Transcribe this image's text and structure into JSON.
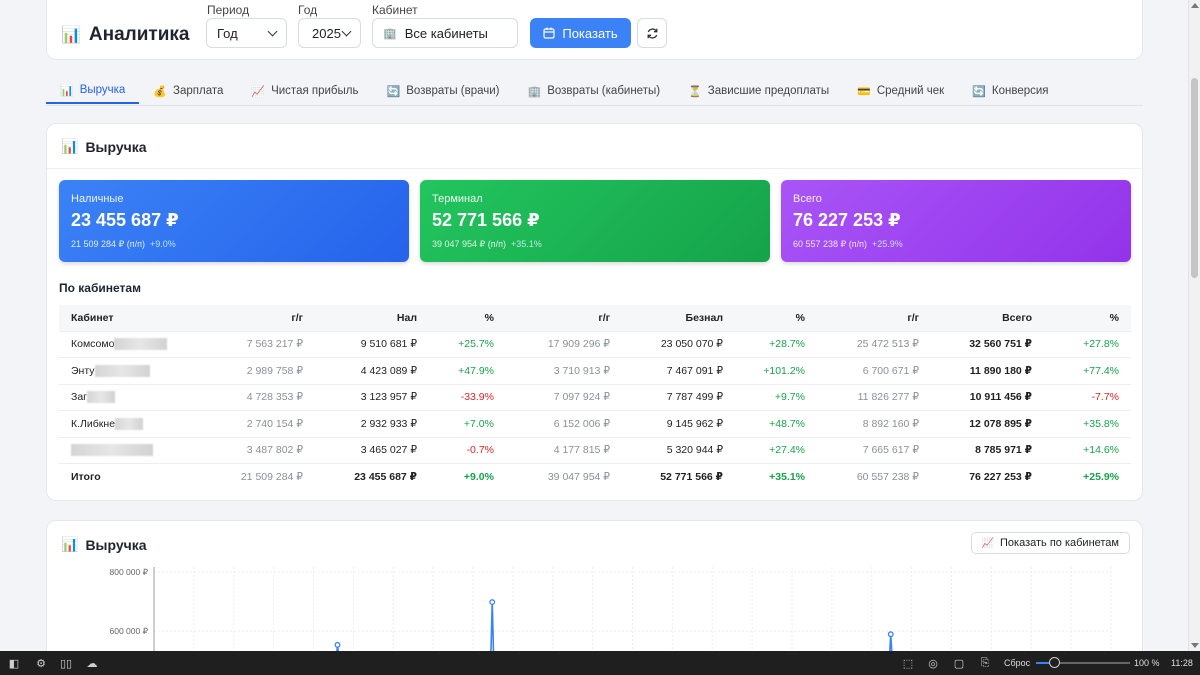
{
  "app": {
    "icon": "bar-chart-icon",
    "title": "Аналитика"
  },
  "filters": {
    "period_label": "Период",
    "period_value": "Год",
    "year_label": "Год",
    "year_value": "2025",
    "cabinet_label": "Кабинет",
    "cabinet_value": "Все кабинеты",
    "show_button": "Показать"
  },
  "tabs": [
    {
      "icon": "bar-chart-icon",
      "glyph": "📊",
      "label": "Выручка",
      "active": true
    },
    {
      "icon": "money-bag-icon",
      "glyph": "💰",
      "label": "Зарплата"
    },
    {
      "icon": "trend-chart-icon",
      "glyph": "📈",
      "label": "Чистая прибыль"
    },
    {
      "icon": "refund-icon",
      "glyph": "🔄",
      "label": "Возвраты (врачи)"
    },
    {
      "icon": "building-icon",
      "glyph": "🏢",
      "label": "Возвраты (кабинеты)"
    },
    {
      "icon": "hourglass-icon",
      "glyph": "⏳",
      "label": "Зависшие предоплаты"
    },
    {
      "icon": "card-icon",
      "glyph": "💳",
      "label": "Средний чек"
    },
    {
      "icon": "conversion-icon",
      "glyph": "🔄",
      "label": "Конверсия"
    }
  ],
  "revenue": {
    "title": "Выручка",
    "cards": [
      {
        "label": "Наличные",
        "value": "23 455 687 ₽",
        "prev": "21 509 284 ₽ (п/п)",
        "change": "+9.0%"
      },
      {
        "label": "Терминал",
        "value": "52 771 566 ₽",
        "prev": "39 047 954 ₽ (п/п)",
        "change": "+35.1%"
      },
      {
        "label": "Всего",
        "value": "76 227 253 ₽",
        "prev": "60 557 238 ₽ (п/п)",
        "change": "+25.9%"
      }
    ],
    "by_cabinet_label": "По кабинетам",
    "columns": [
      "Кабинет",
      "г/г",
      "Нал",
      "%",
      "г/г",
      "Безнал",
      "%",
      "г/г",
      "Всего",
      "%"
    ],
    "rows": [
      [
        "Комсомо",
        "7 563 217 ₽",
        "9 510 681 ₽",
        "+25.7%",
        "17 909 296 ₽",
        "23 050 070 ₽",
        "+28.7%",
        "25 472 513 ₽",
        "32 560 751 ₽",
        "+27.8%"
      ],
      [
        "Энту",
        "2 989 758 ₽",
        "4 423 089 ₽",
        "+47.9%",
        "3 710 913 ₽",
        "7 467 091 ₽",
        "+101.2%",
        "6 700 671 ₽",
        "11 890 180 ₽",
        "+77.4%"
      ],
      [
        "Заг",
        "4 728 353 ₽",
        "3 123 957 ₽",
        "-33.9%",
        "7 097 924 ₽",
        "7 787 499 ₽",
        "+9.7%",
        "11 826 277 ₽",
        "10 911 456 ₽",
        "-7.7%"
      ],
      [
        "К.Либкне",
        "2 740 154 ₽",
        "2 932 933 ₽",
        "+7.0%",
        "6 152 006 ₽",
        "9 145 962 ₽",
        "+48.7%",
        "8 892 160 ₽",
        "12 078 895 ₽",
        "+35.8%"
      ],
      [
        "",
        "3 487 802 ₽",
        "3 465 027 ₽",
        "-0.7%",
        "4 177 815 ₽",
        "5 320 944 ₽",
        "+27.4%",
        "7 665 617 ₽",
        "8 785 971 ₽",
        "+14.6%"
      ]
    ],
    "total": [
      "Итого",
      "21 509 284 ₽",
      "23 455 687 ₽",
      "+9.0%",
      "39 047 954 ₽",
      "52 771 566 ₽",
      "+35.1%",
      "60 557 238 ₽",
      "76 227 253 ₽",
      "+25.9%"
    ]
  },
  "chart_section": {
    "title": "Выручка",
    "by_cabinet_button": "Показать по кабинетам"
  },
  "chart_data": {
    "type": "line",
    "y_ticks": [
      "800 000 ₽",
      "600 000 ₽"
    ],
    "ylim": [
      545000,
      820000
    ],
    "visible_peaks": [
      {
        "day_index": 70,
        "value": 553000
      },
      {
        "day_index": 129,
        "value": 698000
      },
      {
        "day_index": 281,
        "value": 589000
      }
    ],
    "grid": true,
    "color": "#3b82f6"
  },
  "taskbar": {
    "reset_label": "Сброс",
    "zoom": "100 %",
    "zoom_level": 1.0,
    "time": "11:28"
  }
}
